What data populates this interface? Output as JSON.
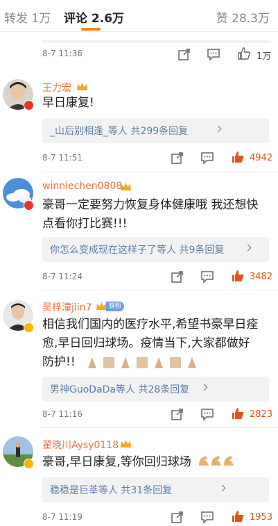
{
  "tabs": {
    "repost": "转发 1万",
    "comments": "评论 2.6万",
    "likes": "赞 28.3万"
  },
  "top_footer": {
    "time": "8-7 11:36",
    "like_count": "1万"
  },
  "comments": [
    {
      "username": "王力宏",
      "text": "早日康复!",
      "reply_summary": "_山后别相逢_等人  共299条回复",
      "time": "8-7 11:51",
      "like_count": "4942"
    },
    {
      "username": "winniechen0808",
      "text_line1": "豪哥一定要努力恢复身体健康哦  我还想快",
      "text_line2": "点看你打比赛!!!",
      "reply_summary": "你怎么变成现在这样子了等人  共9条回复",
      "time": "8-7 11:24",
      "like_count": "3482"
    },
    {
      "username": "吴梓潼jlin7",
      "tag": "铁粉",
      "text_line1": "相信我们国内的医疗水平,希望书豪早日痊",
      "text_line2": "愈,早日回归球场。疫情当下,大家都做好",
      "text_line3": "防护!!",
      "reply_summary": "男神GuoDaDa等人  共28条回复",
      "time": "8-7 11:16",
      "like_count": "2823"
    },
    {
      "username": "翟晓川Aysy0118",
      "text": "豪哥,早日康复,等你回归球场",
      "reply_summary": "稳稳是巨莘等人  共31条回复",
      "time": "8-7 11:19",
      "like_count": "1953"
    }
  ],
  "colors": {
    "accent": "#ff8200",
    "username": "#eb7340",
    "link": "#5b7ea6",
    "like_active": "#e0541c"
  }
}
